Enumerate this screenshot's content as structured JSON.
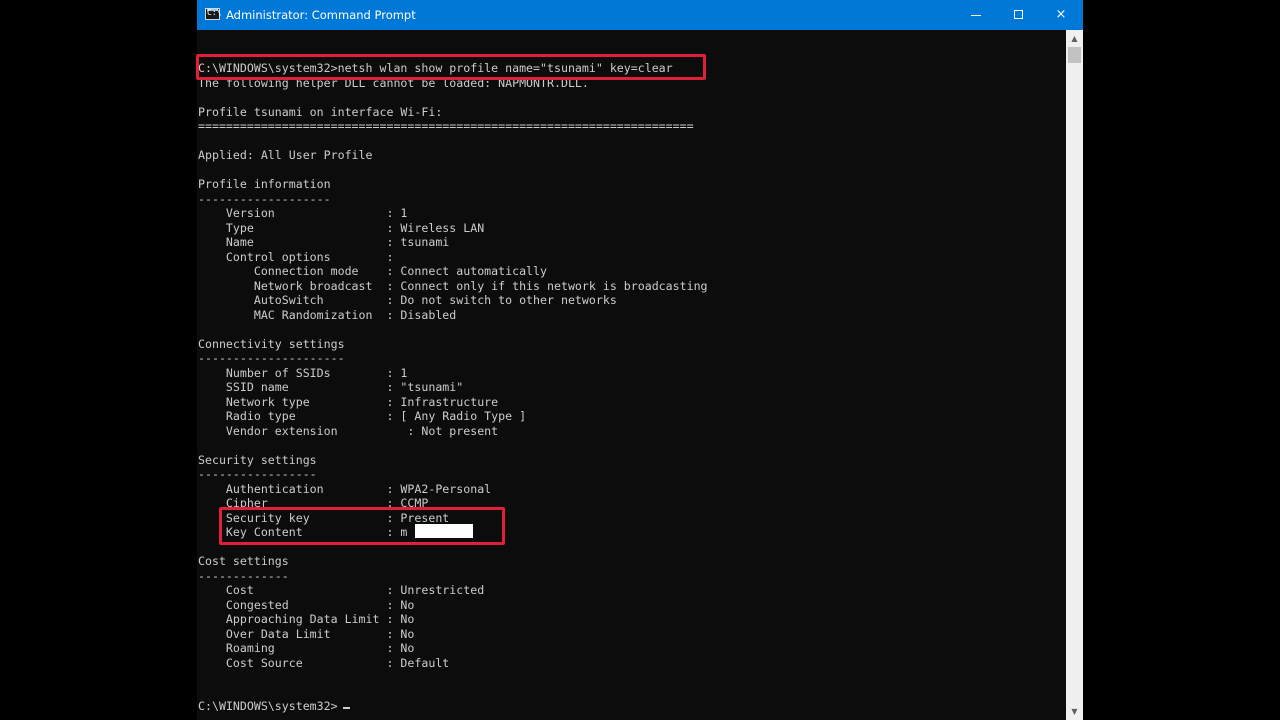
{
  "window": {
    "title": "Administrator: Command Prompt",
    "icon": "cmd-icon",
    "controls": {
      "minimize": "minimize-icon",
      "maximize": "maximize-icon",
      "close": "×"
    }
  },
  "console": {
    "lines": [
      "C:\\WINDOWS\\system32>netsh wlan show profile name=\"tsunami\" key=clear",
      "The following helper DLL cannot be loaded: NAPMONTR.DLL.",
      "",
      "Profile tsunami on interface Wi-Fi:",
      "=======================================================================",
      "",
      "Applied: All User Profile",
      "",
      "Profile information",
      "-------------------",
      "    Version                : 1",
      "    Type                   : Wireless LAN",
      "    Name                   : tsunami",
      "    Control options        :",
      "        Connection mode    : Connect automatically",
      "        Network broadcast  : Connect only if this network is broadcasting",
      "        AutoSwitch         : Do not switch to other networks",
      "        MAC Randomization  : Disabled",
      "",
      "Connectivity settings",
      "---------------------",
      "    Number of SSIDs        : 1",
      "    SSID name              : \"tsunami\"",
      "    Network type           : Infrastructure",
      "    Radio type             : [ Any Radio Type ]",
      "    Vendor extension          : Not present",
      "",
      "Security settings",
      "-----------------",
      "    Authentication         : WPA2-Personal",
      "    Cipher                 : CCMP",
      "    Security key           : Present",
      "    Key Content            : m        i",
      "",
      "Cost settings",
      "-------------",
      "    Cost                   : Unrestricted",
      "    Congested              : No",
      "    Approaching Data Limit : No",
      "    Over Data Limit        : No",
      "    Roaming                : No",
      "    Cost Source            : Default",
      "",
      "",
      "C:\\WINDOWS\\system32>"
    ]
  },
  "colors": {
    "titlebar": "#0078d7",
    "console_bg": "#0c0c0c",
    "console_text": "#cccccc",
    "highlight": "#e0203a"
  }
}
